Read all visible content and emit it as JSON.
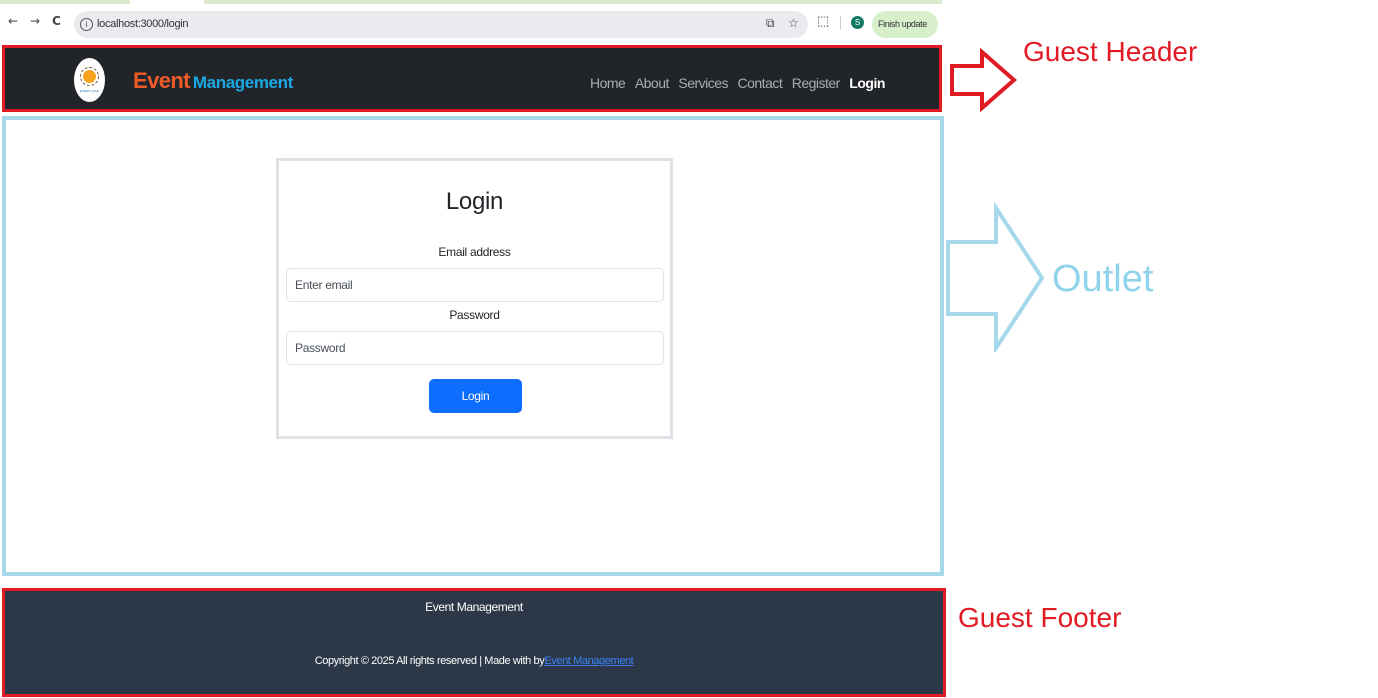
{
  "browser": {
    "url": "localhost:3000/login",
    "back_icon": "←",
    "forward_icon": "→",
    "reload_icon": "C",
    "profile_initial": "S",
    "update_label": "Finish update",
    "update_menu_icon": "⋮"
  },
  "header": {
    "logo_text": "EVENT LOGO",
    "brand_primary": "Event",
    "brand_secondary": "Management",
    "nav": [
      {
        "label": "Home"
      },
      {
        "label": "About"
      },
      {
        "label": "Services"
      },
      {
        "label": "Contact"
      },
      {
        "label": "Register"
      },
      {
        "label": "Login",
        "active": true
      }
    ]
  },
  "login": {
    "title": "Login",
    "email_label": "Email address",
    "email_placeholder": "Enter email",
    "password_label": "Password",
    "password_placeholder": "Password",
    "submit_label": "Login",
    "submit_color": "#0d6efd"
  },
  "footer": {
    "title": "Event Management",
    "copyright": "Copyright © 2025 All rights reserved | Made with by",
    "link_text": "Event Management"
  },
  "annotations": {
    "header_label": "Guest Header",
    "outlet_label": "Outlet",
    "footer_label": "Guest Footer",
    "header_color": "#e01b24",
    "outlet_color": "#a4d8ea",
    "footer_color": "#e01b24"
  }
}
